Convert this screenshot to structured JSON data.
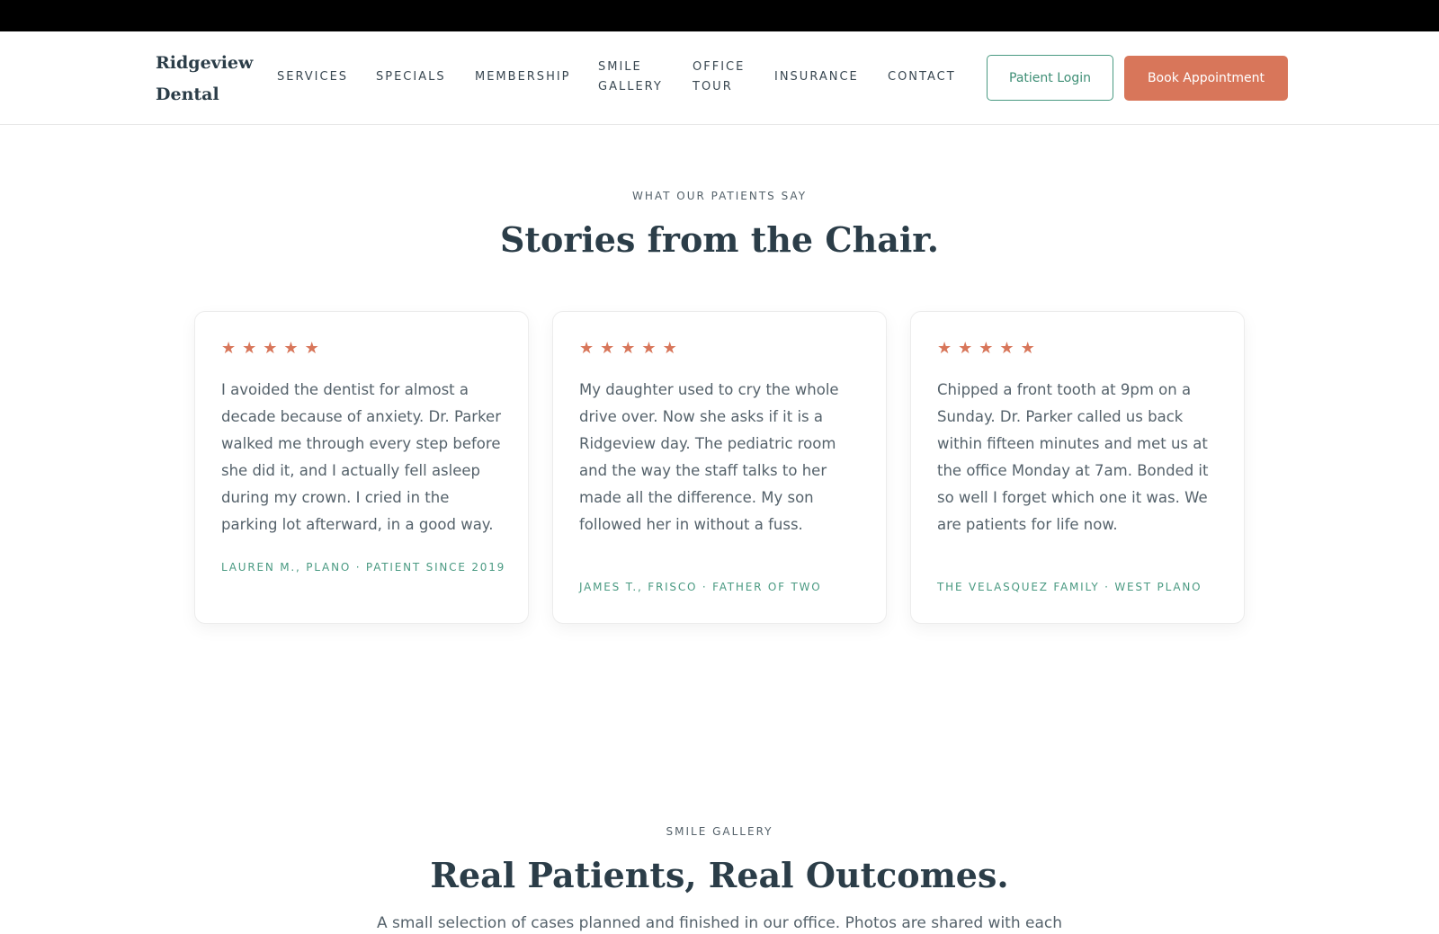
{
  "header": {
    "logo": "Ridgeview\nDental",
    "nav": [
      "SERVICES",
      "SPECIALS",
      "MEMBERSHIP",
      "SMILE\nGALLERY",
      "OFFICE\nTOUR",
      "INSURANCE",
      "CONTACT"
    ],
    "login_label": "Patient Login",
    "book_label": "Book Appointment"
  },
  "testimonials": {
    "eyebrow": "WHAT OUR PATIENTS SAY",
    "title": "Stories from the Chair.",
    "cards": [
      {
        "rating": 5,
        "quote": "I avoided the dentist for almost a decade because of anxiety. Dr. Parker walked me through every step before she did it, and I actually fell asleep during my crown. I cried in the parking lot afterward, in a good way.",
        "attribution": "LAUREN M., PLANO · PATIENT SINCE 2019"
      },
      {
        "rating": 5,
        "quote": "My daughter used to cry the whole drive over. Now she asks if it is a Ridgeview day. The pediatric room and the way the staff talks to her made all the difference. My son followed her in without a fuss.",
        "attribution": "JAMES T., FRISCO · FATHER OF TWO"
      },
      {
        "rating": 5,
        "quote": "Chipped a front tooth at 9pm on a Sunday. Dr. Parker called us back within fifteen minutes and met us at the office Monday at 7am. Bonded it so well I forget which one it was. We are patients for life now.",
        "attribution": "THE VELASQUEZ FAMILY · WEST PLANO"
      }
    ]
  },
  "gallery": {
    "eyebrow": "SMILE GALLERY",
    "title": "Real Patients, Real Outcomes.",
    "subtitle": "A small selection of cases planned and finished in our office. Photos are shared with each"
  },
  "colors": {
    "accent": "#d8765a",
    "green": "#4a9a82",
    "heading": "#2b3d48"
  },
  "icons": {
    "star": "star-icon"
  }
}
